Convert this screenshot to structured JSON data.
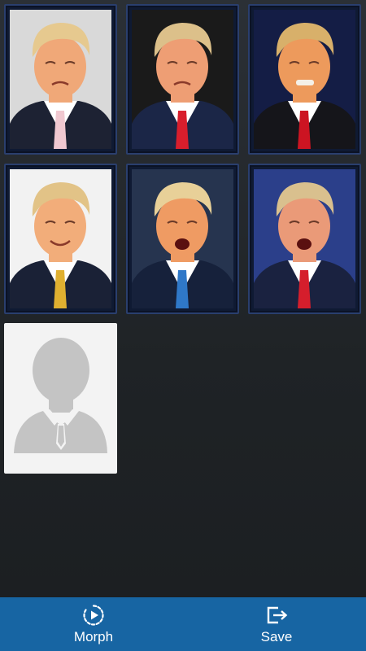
{
  "gallery": {
    "tiles": [
      {
        "type": "photo",
        "bg": "#d9d9d9",
        "hair": "#e6c98f",
        "skin": "#f0a878",
        "suit": "#1d2233",
        "shirt": "#ffffff",
        "tie": "#f0c8d0",
        "expression": "frown"
      },
      {
        "type": "photo",
        "bg": "#1a1a1a",
        "hair": "#dcc08a",
        "skin": "#ee9e74",
        "suit": "#1b2647",
        "shirt": "#ffffff",
        "tie": "#d81e2c",
        "expression": "pout"
      },
      {
        "type": "photo",
        "bg": "#141d45",
        "hair": "#d8b06a",
        "skin": "#ed9a5c",
        "suit": "#15151a",
        "shirt": "#ffffff",
        "tie": "#cc1422",
        "expression": "grimace"
      },
      {
        "type": "photo",
        "bg": "#f2f2f2",
        "hair": "#e2c387",
        "skin": "#f2ad7a",
        "suit": "#1a2136",
        "shirt": "#ffffff",
        "tie": "#e0b030",
        "expression": "smile"
      },
      {
        "type": "photo",
        "bg": "#26344f",
        "hair": "#e8d098",
        "skin": "#ef9b63",
        "suit": "#16213b",
        "shirt": "#ffffff",
        "tie": "#2f78c8",
        "expression": "shout"
      },
      {
        "type": "photo",
        "bg": "#2b3f8a",
        "hair": "#d9c08e",
        "skin": "#ea9a78",
        "suit": "#1a2240",
        "shirt": "#ffffff",
        "tie": "#d51e2c",
        "expression": "speak"
      },
      {
        "type": "placeholder",
        "bg": "#f3f3f3",
        "silhouette": "#c4c4c4",
        "icon": "person-placeholder-icon"
      }
    ]
  },
  "bottom_bar": {
    "bg": "#1765a3",
    "morph": {
      "label": "Morph",
      "icon": "play-circle-icon"
    },
    "save": {
      "label": "Save",
      "icon": "export-icon"
    }
  }
}
